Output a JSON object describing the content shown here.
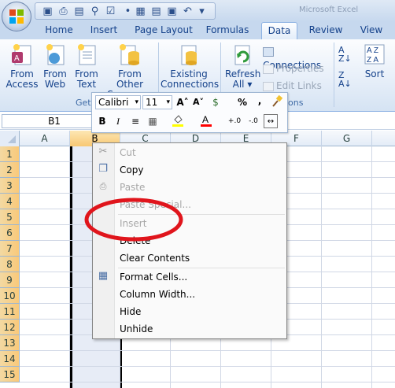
{
  "title_right": "Microsoft Excel",
  "tabs": [
    "Home",
    "Insert",
    "Page Layout",
    "Formulas",
    "Data",
    "Review",
    "View"
  ],
  "active_tab": "Data",
  "ribbon": {
    "get_external": {
      "label": "Get External Data",
      "label_visible": "Get",
      "buttons": [
        {
          "line1": "From",
          "line2": "Access"
        },
        {
          "line1": "From",
          "line2": "Web"
        },
        {
          "line1": "From",
          "line2": "Text"
        },
        {
          "line1": "From Other",
          "line2": "Sources ▾"
        }
      ]
    },
    "existing": {
      "line1": "Existing",
      "line2": "Connections"
    },
    "connections": {
      "label_visible": "ons",
      "refresh": {
        "line1": "Refresh",
        "line2": "All ▾"
      },
      "connections": "Connections",
      "properties": "Properties",
      "edit_links": "Edit Links"
    },
    "sort": {
      "label": "Sort"
    }
  },
  "mini_toolbar": {
    "font": "Calibri",
    "size": "11",
    "font_arrow": "▾",
    "grow_icon": "A˄",
    "shrink_icon": "A˅",
    "currency_icon": "$",
    "percent_icon": "%",
    "comma_icon": ",",
    "painter_icon": "🖌",
    "bold": "B",
    "italic": "I",
    "align_icon": "≡",
    "border_icon": "▦",
    "fill_icon": "◆",
    "font_color_icon": "A",
    "inc_decimal": "+.0",
    "dec_decimal": "-.0",
    "merge_icon": "↔",
    "fill_color": "#ffff00",
    "font_color": "#ff0000"
  },
  "name_box": "B1",
  "columns": [
    "A",
    "B",
    "C",
    "D",
    "E",
    "F",
    "G"
  ],
  "rows": [
    "1",
    "2",
    "3",
    "4",
    "5",
    "6",
    "7",
    "8",
    "9",
    "10",
    "11",
    "12",
    "13",
    "14",
    "15"
  ],
  "selected_column": "B",
  "context_menu": [
    {
      "label": "Cut",
      "disabled": true,
      "icon": "✂"
    },
    {
      "label": "Copy",
      "disabled": false,
      "icon": "❐"
    },
    {
      "label": "Paste",
      "disabled": true,
      "icon": "📋"
    },
    {
      "label": "Paste Special...",
      "disabled": true,
      "icon": ""
    },
    {
      "label": "Insert",
      "disabled": true,
      "icon": ""
    },
    {
      "label": "Delete",
      "disabled": false,
      "icon": ""
    },
    {
      "label": "Clear Contents",
      "disabled": false,
      "icon": ""
    },
    {
      "label": "Format Cells...",
      "disabled": false,
      "icon": "▦"
    },
    {
      "label": "Column Width...",
      "disabled": false,
      "icon": ""
    },
    {
      "label": "Hide",
      "disabled": false,
      "icon": ""
    },
    {
      "label": "Unhide",
      "disabled": false,
      "icon": ""
    }
  ],
  "colors": {
    "annotation": "#e0151c",
    "ribbon_text": "#15428b",
    "row_header": "#f9c97a"
  }
}
